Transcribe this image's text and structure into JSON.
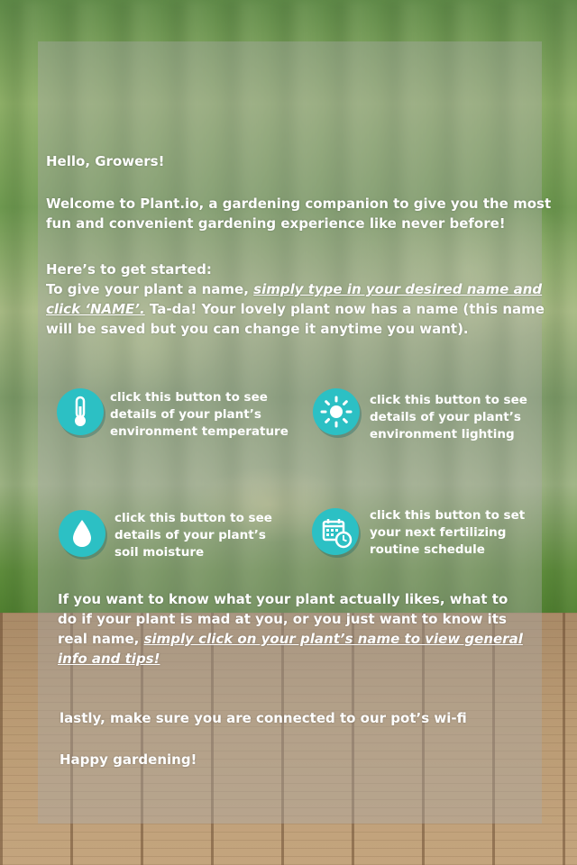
{
  "intro": {
    "greeting": "Hello, Growers!",
    "welcome_line1": "Welcome to Plant.io, a gardening companion to give you the most",
    "welcome_line2": "fun and convenient gardening experience like never before!",
    "start_heading": "Here’s to get started:",
    "start_line1_plain": "To give your plant a name, ",
    "start_line1_link": "simply type in your desired name and",
    "start_line2_link": "click ‘NAME’.",
    "start_line2_plain": " Ta-da! Your lovely plant now has a name (this name",
    "start_line3": "will be saved but you can change it anytime you want)."
  },
  "features": [
    {
      "icon": "thermometer-icon",
      "lines": [
        "click this button to see",
        "details of your plant’s",
        "environment temperature"
      ]
    },
    {
      "icon": "sun-icon",
      "lines": [
        "click this button to see",
        "details of your plant’s",
        "environment lighting"
      ]
    },
    {
      "icon": "water-drop-icon",
      "lines": [
        "click this button to see",
        "details of your plant’s",
        "soil moisture"
      ]
    },
    {
      "icon": "calendar-icon",
      "lines": [
        "click this button to set",
        "your next fertilizing",
        "routine schedule"
      ]
    }
  ],
  "info": {
    "line1": "If you want to know what your plant actually likes, what to",
    "line2": "do if your plant is mad at you, or you just want  to know its",
    "line3_plain": "real name, ",
    "line3_link": "simply click on your plant’s name to view general",
    "line4_link": "info and tips!"
  },
  "outro": {
    "wifi": "lastly, make sure you are connected to our pot’s wi-fi",
    "signoff": "Happy gardening!"
  },
  "colors": {
    "icon_bg": "#2cc0c4",
    "text": "#ffffff"
  }
}
